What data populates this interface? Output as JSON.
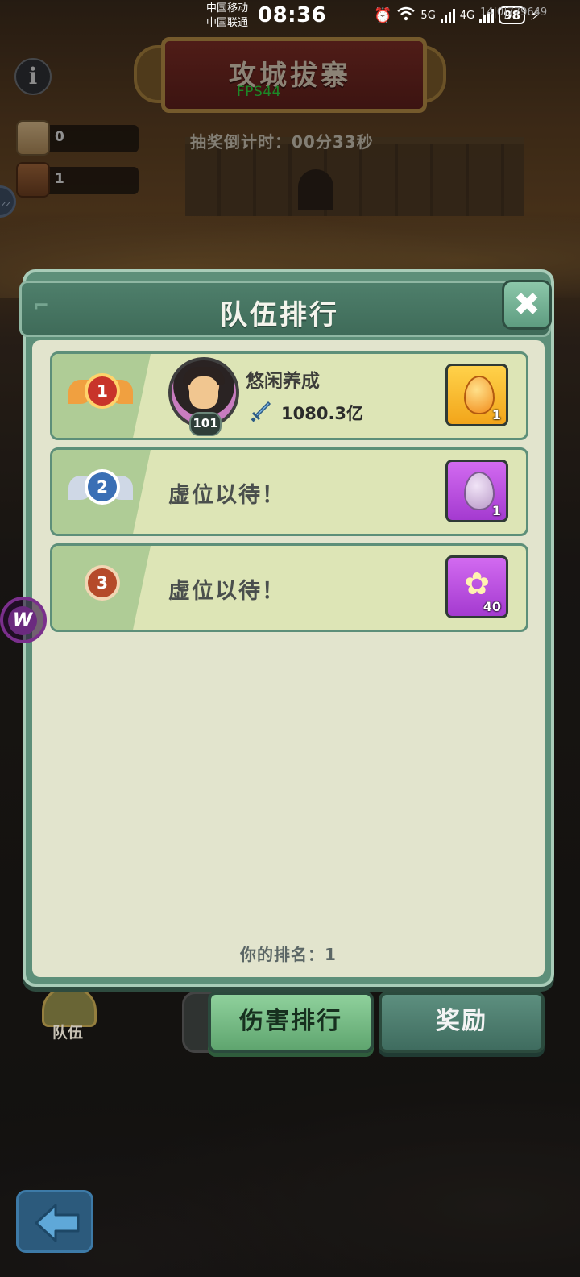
{
  "status_bar": {
    "carrier_1": "中国移动",
    "carrier_2": "中国联通",
    "time": "08:36",
    "net_1": "5G",
    "net_2": "4G",
    "battery": "98",
    "net_speed": "14|0|779649"
  },
  "header": {
    "title": "攻城拔寨",
    "fps": "FPS44",
    "countdown": "抽奖倒计时：00分33秒"
  },
  "resources": [
    {
      "icon": "scroll-icon",
      "value": "0"
    },
    {
      "icon": "cart-icon",
      "value": "1"
    }
  ],
  "side_badge": "zz",
  "floating_button": "W",
  "modal": {
    "title": "队伍排行",
    "close_icon": "close-icon",
    "rows": [
      {
        "rank": "1",
        "player_name": "悠闲养成",
        "level": "101",
        "power": "1080.3亿",
        "reward_icon": "golden-egg-icon",
        "reward_count": "1"
      },
      {
        "rank": "2",
        "empty_text": "虚位以待！",
        "reward_icon": "purple-egg-icon",
        "reward_count": "1"
      },
      {
        "rank": "3",
        "empty_text": "虚位以待！",
        "reward_icon": "flower-icon",
        "reward_count": "40"
      }
    ],
    "my_rank": "你的排名：1"
  },
  "tabs": {
    "damage_rank": "伤害排行",
    "rewards": "奖励"
  },
  "team_button": {
    "label": "队伍"
  },
  "colors": {
    "panel_green": "#5d8f79",
    "panel_body": "#e2e4cd",
    "rank_gold": "#c8342a",
    "rank_silver": "#3a6fb5",
    "rank_bronze": "#b54a2a",
    "reward_gold": "#f2a51a",
    "reward_purple": "#a43ad0"
  }
}
